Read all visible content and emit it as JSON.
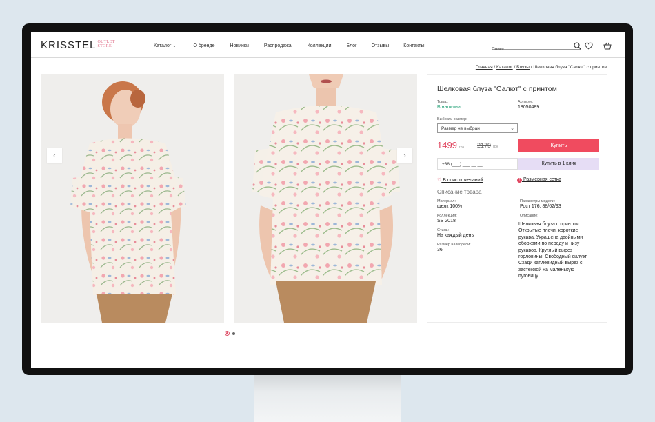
{
  "colors": {
    "accent": "#f04b5f",
    "instock": "#2aa37a",
    "oneclick": "#e6ddf5",
    "page_bg": "#dde7ee"
  },
  "header": {
    "logo_main": "KRISSTEL",
    "logo_sub_1": "OUTLET",
    "logo_sub_2": "STORE",
    "nav": [
      "Каталог",
      "О бренде",
      "Новинки",
      "Распродажа",
      "Коллекции",
      "Блог",
      "Отзывы",
      "Контакты"
    ],
    "search_placeholder": "Поиск",
    "icons": [
      "search-icon",
      "heart-icon",
      "basket-icon"
    ]
  },
  "breadcrumb": {
    "items": [
      "Главная",
      "Каталог",
      "Блузы"
    ],
    "current": "Шелковая блуза \"Салют\" с принтом"
  },
  "product": {
    "title": "Шелковая блуза \"Салют\" с принтом",
    "stock_label": "Товар:",
    "stock_value": "В наличии",
    "sku_label": "Артикул:",
    "sku_value": "18050489",
    "size_label": "Выбрать размер:",
    "size_select": "Размер не выбран",
    "price": "1499",
    "old_price": "2179",
    "currency": "грн",
    "buy_label": "Купить",
    "phone_placeholder": "+38 (___) ___ __ __",
    "oneclick_label": "Купить в 1 клик",
    "wishlist_label": "В список желаний",
    "size_chart_label": "Размерная сетка",
    "description_heading": "Описание товара",
    "material_label": "Материал:",
    "material_value": "шелк 100%",
    "collection_label": "Коллекция:",
    "collection_value": "SS 2018",
    "style_label": "Стиль:",
    "style_value": "На каждый день",
    "model_size_label": "Размер на модели:",
    "model_size_value": "36",
    "model_params_label": "Параметры модели:",
    "model_params_value": "Рост 176, 88/62/93",
    "description_label": "Описание:",
    "description_lines": [
      "Шелковая блуза с принтом.",
      "Открытые плечи, короткие",
      "рукава. Украшена двойными",
      "оборками по переду и низу",
      "рукавов. Круглый вырез",
      "горловины. Свободный силуэт.",
      "Сзади каплевидный вырез с",
      "застежкой на маленькую",
      "пуговицу."
    ]
  },
  "gallery": {
    "slides": 2,
    "active_slide": 1
  }
}
